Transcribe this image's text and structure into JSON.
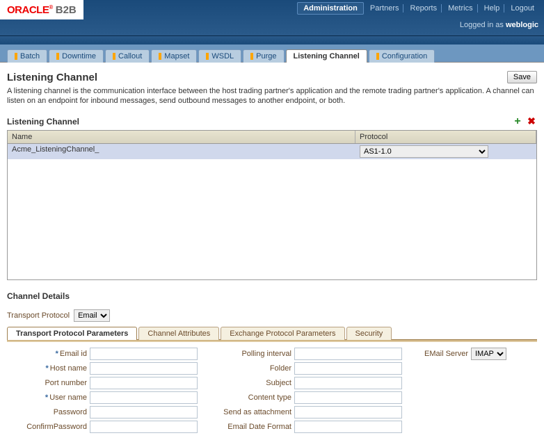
{
  "header": {
    "brand_oracle": "ORACLE",
    "brand_suffix": "B2B",
    "links": [
      "Administration",
      "Partners",
      "Reports",
      "Metrics",
      "Help",
      "Logout"
    ],
    "active_link_index": 0,
    "logged_in_prefix": "Logged in as ",
    "logged_in_user": "weblogic"
  },
  "tabs": {
    "items": [
      "Batch",
      "Downtime",
      "Callout",
      "Mapset",
      "WSDL",
      "Purge",
      "Listening Channel",
      "Configuration"
    ],
    "active_index": 6
  },
  "page": {
    "title": "Listening Channel",
    "save_label": "Save",
    "description": "A listening channel is the communication interface between the host trading partner's application and the remote trading partner's application. A channel can listen on an endpoint for inbound messages, send outbound messages to another endpoint, or both."
  },
  "grid": {
    "section_title": "Listening Channel",
    "col_name": "Name",
    "col_protocol": "Protocol",
    "rows": [
      {
        "name": "Acme_ListeningChannel_",
        "protocol": "AS1-1.0"
      }
    ]
  },
  "details": {
    "title": "Channel Details",
    "transport_protocol_label": "Transport Protocol",
    "transport_protocol_value": "Email",
    "subtabs": [
      "Transport Protocol Parameters",
      "Channel Attributes",
      "Exchange Protocol Parameters",
      "Security"
    ],
    "active_subtab_index": 0,
    "fields_col1": [
      {
        "label": "Email id",
        "required": true,
        "value": ""
      },
      {
        "label": "Host name",
        "required": true,
        "value": ""
      },
      {
        "label": "Port number",
        "required": false,
        "value": ""
      },
      {
        "label": "User name",
        "required": true,
        "value": ""
      },
      {
        "label": "Password",
        "required": false,
        "value": ""
      },
      {
        "label": "ConfirmPassword",
        "required": false,
        "value": ""
      }
    ],
    "fields_col2": [
      {
        "label": "Polling interval",
        "value": ""
      },
      {
        "label": "Folder",
        "value": ""
      },
      {
        "label": "Subject",
        "value": ""
      },
      {
        "label": "Content type",
        "value": ""
      },
      {
        "label": "Send as attachment",
        "value": ""
      },
      {
        "label": "Email Date Format",
        "value": ""
      }
    ],
    "fields_col3": {
      "email_server_label": "EMail Server",
      "email_server_value": "IMAP"
    }
  }
}
